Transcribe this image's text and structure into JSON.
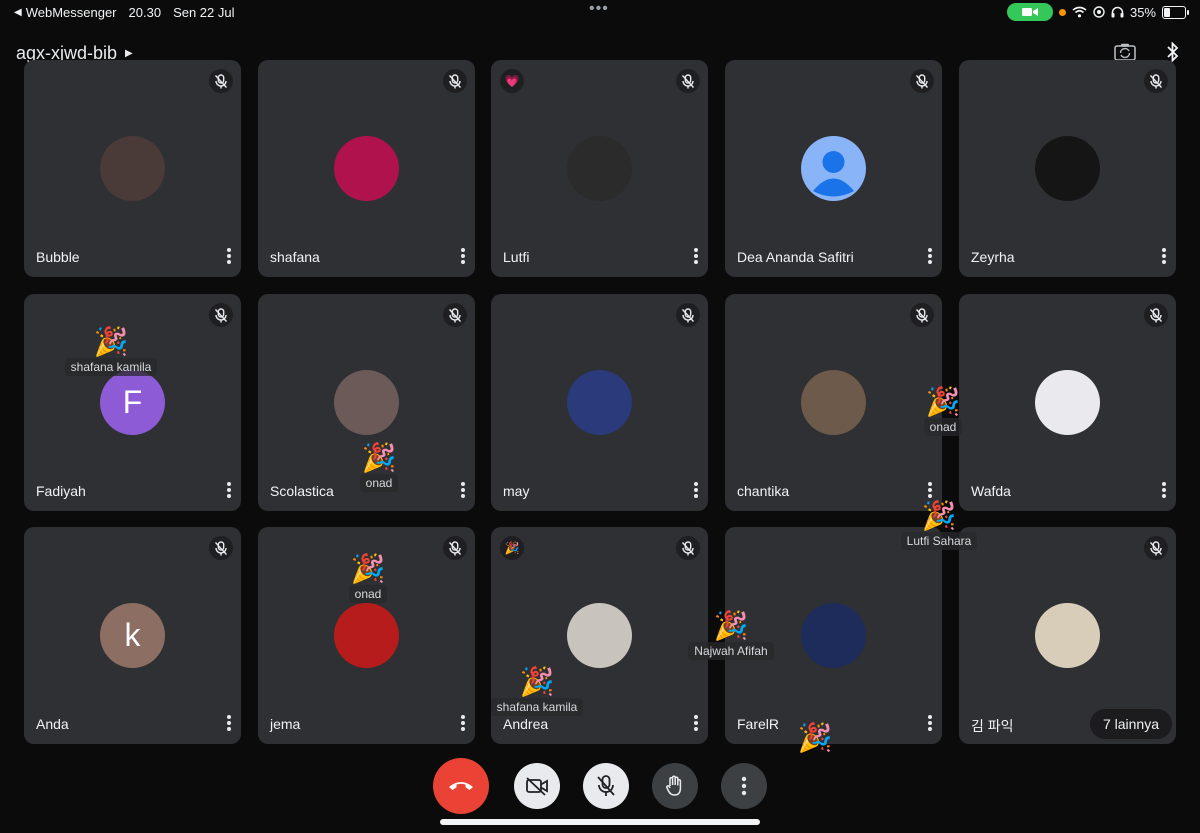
{
  "status_bar": {
    "back_app": "WebMessenger",
    "time": "20.30",
    "date": "Sen 22 Jul",
    "battery": "35%",
    "battery_level": 0.35
  },
  "header": {
    "meeting_code": "agx-xjwd-bib"
  },
  "participants": [
    {
      "name": "Bubble",
      "avatar_color": "#4a3a38",
      "initial": "",
      "muted": true
    },
    {
      "name": "shafana",
      "avatar_color": "#b0124e",
      "initial": "",
      "muted": true
    },
    {
      "name": "Lutfi",
      "avatar_color": "#2b2b2b",
      "initial": "",
      "muted": true,
      "reaction": "💗"
    },
    {
      "name": "Dea Ananda Safitri",
      "avatar_color": "#8ab4f8",
      "initial": "",
      "muted": true,
      "default_avatar": true
    },
    {
      "name": "Zeyrha",
      "avatar_color": "#151515",
      "initial": "",
      "muted": true
    },
    {
      "name": "Fadiyah",
      "avatar_color": "#8e5bd6",
      "initial": "F",
      "muted": true
    },
    {
      "name": "Scolastica",
      "avatar_color": "#6b5a58",
      "initial": "",
      "muted": true
    },
    {
      "name": "may",
      "avatar_color": "#2a3a7a",
      "initial": "",
      "muted": true
    },
    {
      "name": "chantika",
      "avatar_color": "#6d5a4b",
      "initial": "",
      "muted": true
    },
    {
      "name": "Wafda",
      "avatar_color": "#e9e9ee",
      "initial": "",
      "muted": true
    },
    {
      "name": "Anda",
      "avatar_color": "#8d6e63",
      "initial": "k",
      "muted": true
    },
    {
      "name": "jema",
      "avatar_color": "#b71c1c",
      "initial": "",
      "muted": true
    },
    {
      "name": "Andrea",
      "avatar_color": "#c8c3bd",
      "initial": "",
      "muted": true,
      "reaction": "🎉"
    },
    {
      "name": "FarelR",
      "avatar_color": "#1d2c5a",
      "initial": "",
      "muted": false
    },
    {
      "name": "김 파익",
      "avatar_color": "#d8cdb8",
      "initial": "",
      "muted": true
    }
  ],
  "more_participants": "7 lainnya",
  "reactions": [
    {
      "emoji": "🎉",
      "who": "shafana kamila"
    },
    {
      "emoji": "🎉",
      "who": "onad"
    },
    {
      "emoji": "🎉",
      "who": "onad"
    },
    {
      "emoji": "🎉",
      "who": "Lutfi Sahara"
    },
    {
      "emoji": "🎉",
      "who": "onad"
    },
    {
      "emoji": "🎉",
      "who": "Najwah Afifah"
    },
    {
      "emoji": "🎉",
      "who": "shafana kamila"
    },
    {
      "emoji": "🎉",
      "who": ""
    }
  ],
  "colors": {
    "tile_bg": "#2f3033",
    "end_call": "#ea4335",
    "camera_pill": "#34c759"
  },
  "icons": {
    "mute": "mic-off-icon",
    "menu": "more-vert-icon",
    "camera": "videocam-off-icon",
    "raise_hand": "hand-icon",
    "end": "call-end-icon"
  }
}
